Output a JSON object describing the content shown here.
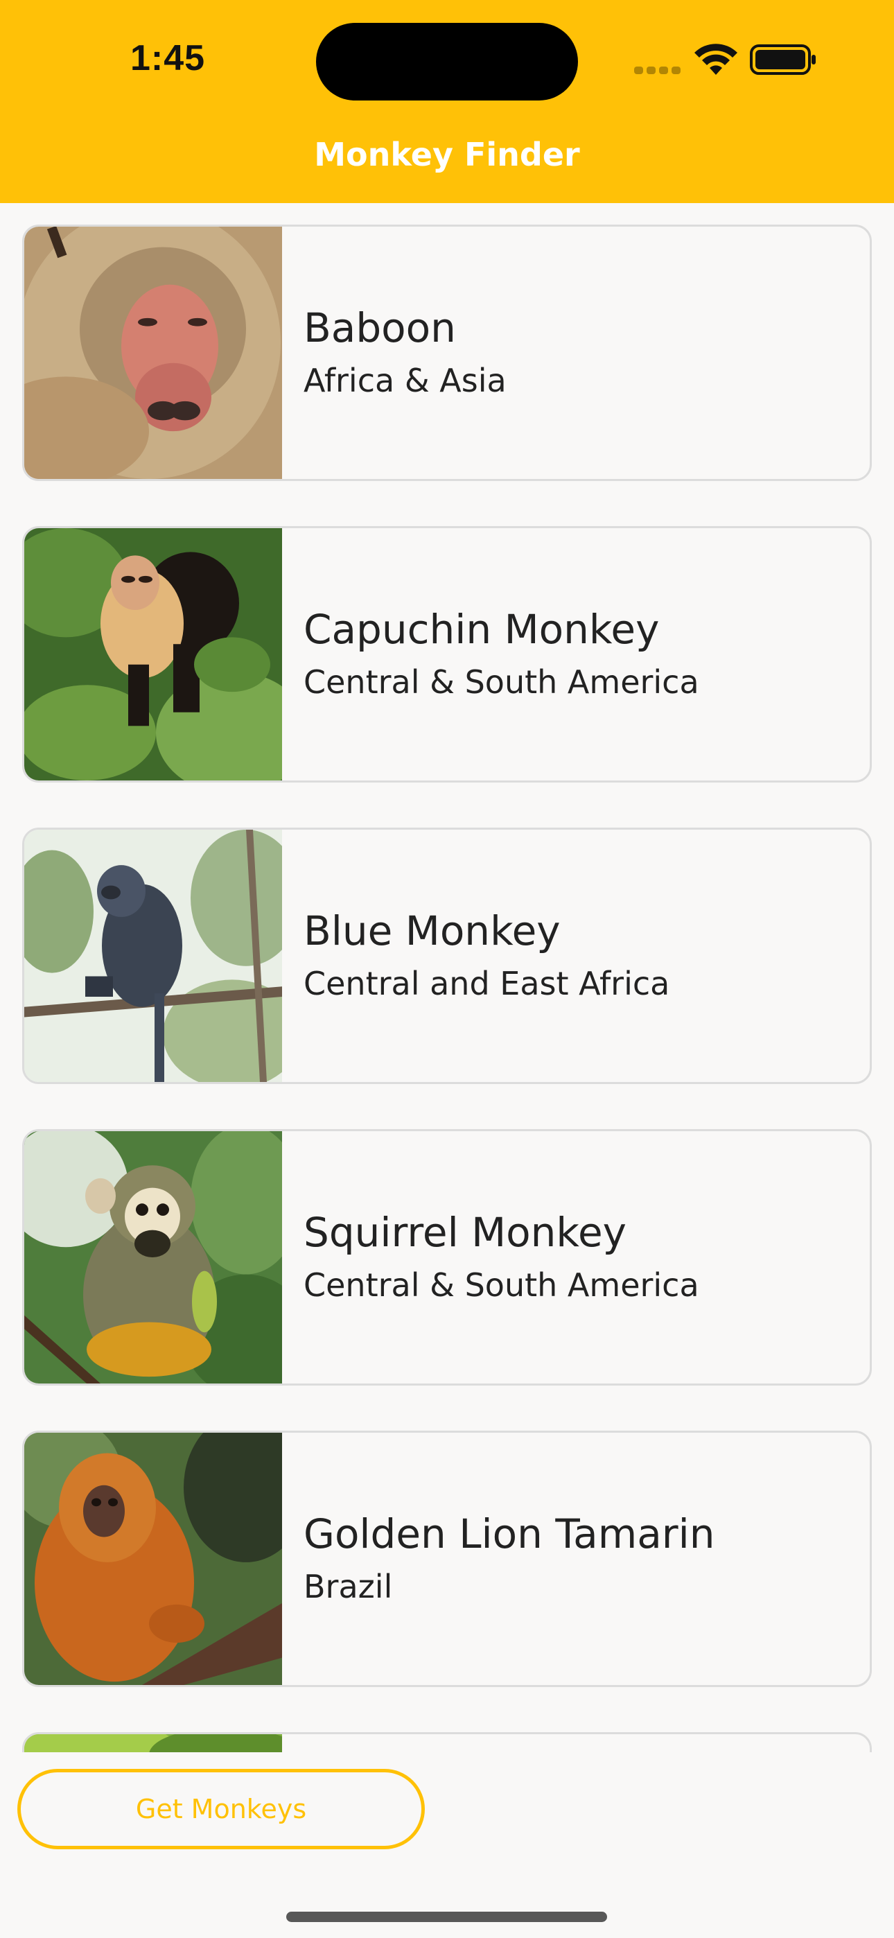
{
  "status_bar": {
    "time": "1:45",
    "icons": [
      "cellular-signal-icon",
      "wifi-icon",
      "battery-icon"
    ]
  },
  "header": {
    "title": "Monkey Finder",
    "color": "#FFC107"
  },
  "monkeys": [
    {
      "name": "Baboon",
      "location": "Africa & Asia",
      "photo": "baboon-photo"
    },
    {
      "name": "Capuchin Monkey",
      "location": "Central & South America",
      "photo": "capuchin-photo"
    },
    {
      "name": "Blue Monkey",
      "location": "Central and East Africa",
      "photo": "blue-monkey-photo"
    },
    {
      "name": "Squirrel Monkey",
      "location": "Central & South America",
      "photo": "squirrel-monkey-photo"
    },
    {
      "name": "Golden Lion Tamarin",
      "location": "Brazil",
      "photo": "tamarin-photo"
    }
  ],
  "actions": {
    "get_monkeys_label": "Get Monkeys"
  },
  "colors": {
    "accent": "#FFC107",
    "background": "#F9F8F7",
    "card_border": "#DCDCDC"
  }
}
